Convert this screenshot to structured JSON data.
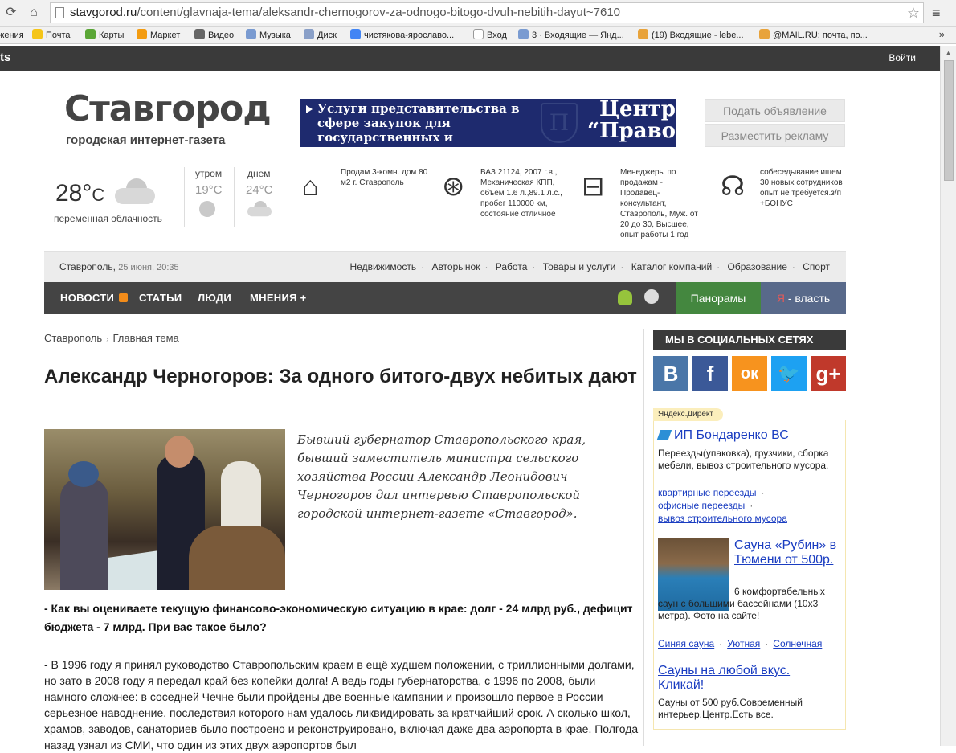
{
  "browser": {
    "url_domain": "stavgorod.ru",
    "url_path": "/content/glavnaja-tema/aleksandr-chernogorov-za-odnogo-bitogo-dvuh-nebitih-dayut~7610",
    "bookmarks": [
      "жения",
      "Почта",
      "Карты",
      "Маркет",
      "Видео",
      "Музыка",
      "Диск",
      "чистякова-ярославо...",
      "Вход",
      "3 · Входящие — Янд...",
      "(19) Входящие - lebe...",
      "@MAIL.RU: почта, по..."
    ],
    "more": "»"
  },
  "topbar": {
    "left": "ts",
    "login": "Войти"
  },
  "header": {
    "logo": "Ставгород",
    "tagline": "городская интернет-газета",
    "banner_text": "Услуги представительства в сфере закупок для государственных и муниципальных нужд",
    "banner_brand": "Центр “Право”",
    "banner_shield": "П",
    "btn_post": "Подать объявление",
    "btn_ad": "Разместить рекламу"
  },
  "weather": {
    "now_temp": "28°",
    "now_unit": "C",
    "now_desc": "переменная облачность",
    "morning_label": "утром",
    "morning_temp": "19°C",
    "day_label": "днем",
    "day_temp": "24°C"
  },
  "classifieds": [
    {
      "icon": "house-icon",
      "text": "Продам 3-комн. дом 80 м2 г. Ставрополь"
    },
    {
      "icon": "steering-wheel-icon",
      "text": "ВАЗ 21124, 2007 г.в., Механическая КПП, объём 1.6 л.,89.1 л.с., пробег 110000 км, состояние отличное"
    },
    {
      "icon": "briefcase-icon",
      "text": "Менеджеры по продажам - Продавец-консультант, Ставрополь, Муж. от 20 до 30, Высшее, опыт работы 1 год"
    },
    {
      "icon": "speaking-head-icon",
      "text": "собеседывание ищем 30 новых сотрудников опыт не требуется.з/п +БОНУС"
    }
  ],
  "citybar": {
    "city": "Ставрополь,",
    "date": "25 июня, 20:35",
    "categories": [
      "Недвижимость",
      "Авторынок",
      "Работа",
      "Товары и услуги",
      "Каталог компаний",
      "Образование",
      "Спорт"
    ]
  },
  "mainnav": {
    "items": [
      "НОВОСТИ",
      "СТАТЬИ",
      "ЛЮДИ",
      "МНЕНИЯ +"
    ],
    "panoramy": "Панорамы",
    "ya_letter": "Я",
    "ya_rest": " - власть"
  },
  "article": {
    "crumbs": [
      "Ставрополь",
      "Главная тема"
    ],
    "title": "Александр Черногоров: За одного битого-двух небитых дают",
    "lead": "Бывший губернатор Ставропольского края, бывший заместитель министра сельского хозяйства России Александр Леонидович Черногоров дал интервью Ставропольской городской интернет-газете «Ставгород».",
    "question": "- Как вы оцениваете текущую финансово-экономическую ситуацию в крае: долг - 24 млрд руб., дефицит бюджета - 7 млрд. При вас такое было?",
    "answer": "- В 1996 году я принял руководство Ставропольским краем в ещё худшем положении, с триллионными долгами, но зато в 2008 году я передал край без копейки долга! А ведь годы губернаторства, с 1996 по 2008, были намного сложнее: в соседней Чечне были пройдены две военные кампании и произошло первое в России серьезное наводнение, последствия которого нам удалось ликвидировать за кратчайший срок. А сколько школ, храмов, заводов, санаториев было построено и реконструировано, включая даже два аэропорта в крае. Полгода назад узнал из СМИ, что один из этих двух аэропортов был"
  },
  "sidebar": {
    "social_title": "МЫ В СОЦИАЛЬНЫХ СЕТЯХ",
    "social": [
      {
        "glyph": "В",
        "color": "#4a76a8"
      },
      {
        "glyph": "f",
        "color": "#3b5998"
      },
      {
        "glyph": "ок",
        "color": "#f7931e"
      },
      {
        "glyph": "🐦",
        "color": "#1da1f2"
      },
      {
        "glyph": "g+",
        "color": "#c0392b"
      }
    ],
    "direct_label": "Яндекс.Директ",
    "ad1_title": "ИП Бондаренко ВС",
    "ad1_text": "Переезды(упаковка), грузчики, сборка мебели, вывоз строительного мусора.",
    "ad1_links": [
      "квартирные переезды",
      "офисные переезды",
      "вывоз строительного мусора"
    ],
    "ad2_title": "Сауна «Рубин» в Тюмени от 500р.",
    "ad2_text": "6 комфортабельных саун с большими бассейнами (10х3 метра). Фото на сайте!",
    "ad2_links": [
      "Синяя сауна",
      "Уютная",
      "Солнечная"
    ],
    "ad3_title": "Сауны на любой вкус. Кликай!",
    "ad3_text": "Сауны от 500 руб.Современный интерьер.Центр.Есть все."
  }
}
